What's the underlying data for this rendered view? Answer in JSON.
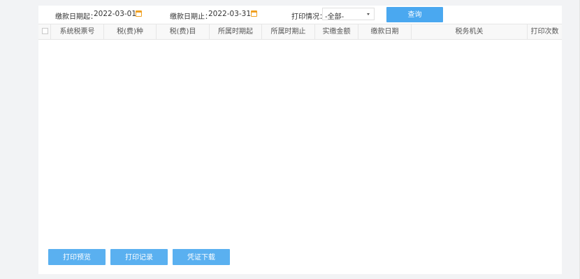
{
  "filters": {
    "start_label": "缴款日期起：",
    "start_value": "2022-03-01",
    "end_label": "缴款日期止：",
    "end_value": "2022-03-31",
    "print_label": "打印情况：",
    "print_value": "-全部-",
    "query_label": "查询"
  },
  "table": {
    "headers": [
      "系统税票号",
      "税(费)种",
      "税(费)目",
      "所属时期起",
      "所属时期止",
      "实缴金额",
      "缴款日期",
      "税务机关",
      "打印次数"
    ],
    "rows": []
  },
  "actions": {
    "preview_label": "打印预览",
    "record_label": "打印记录",
    "download_label": "凭证下载"
  },
  "colors": {
    "primary_button": "#4aa8f0",
    "calendar_icon": "#f0a020"
  }
}
